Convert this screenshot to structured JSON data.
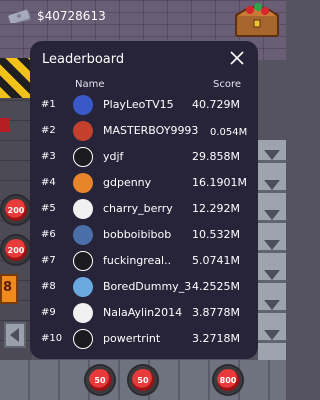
{
  "hud": {
    "money": "$40728613",
    "money_icon": "cash-stack-icon",
    "chest_icon": "treasure-chest-icon"
  },
  "leaderboard": {
    "title": "Leaderboard",
    "close_icon": "close-icon",
    "columns": {
      "name": "Name",
      "score": "Score"
    },
    "rows": [
      {
        "rank": "#1",
        "name": "PlayLeoTV15",
        "score": "40.729M",
        "avatar": "avatar-1",
        "avatar_color": "#3a59c9"
      },
      {
        "rank": "#2",
        "name": "MASTERBOY9993",
        "score": "0.054M",
        "avatar": "avatar-2",
        "avatar_color": "#c2402c"
      },
      {
        "rank": "#3",
        "name": "ydjf",
        "score": "29.858M",
        "avatar": "avatar-3",
        "avatar_color": "#1b1b1f"
      },
      {
        "rank": "#4",
        "name": "gdpenny",
        "score": "16.1901M",
        "avatar": "avatar-4",
        "avatar_color": "#e8842a"
      },
      {
        "rank": "#5",
        "name": "charry_berry",
        "score": "12.292M",
        "avatar": "avatar-5",
        "avatar_color": "#f1f1f1"
      },
      {
        "rank": "#6",
        "name": "bobboibibob",
        "score": "10.532M",
        "avatar": "avatar-6",
        "avatar_color": "#4a6ea8"
      },
      {
        "rank": "#7",
        "name": "fuckingreal..",
        "score": "5.0741M",
        "avatar": "avatar-7",
        "avatar_color": "#1b1b1f"
      },
      {
        "rank": "#8",
        "name": "BoredDummy_3",
        "score": "4.2525M",
        "avatar": "avatar-8",
        "avatar_color": "#6aa8e0"
      },
      {
        "rank": "#9",
        "name": "NalaAylin2014",
        "score": "3.8778M",
        "avatar": "avatar-9",
        "avatar_color": "#f1f1f1"
      },
      {
        "rank": "#10",
        "name": "powertrint",
        "score": "3.2718M",
        "avatar": "avatar-10",
        "avatar_color": "#1b1b1f"
      }
    ]
  },
  "game": {
    "button_200_a": "200",
    "button_200_b": "200",
    "tile_value": "8",
    "button_50_a": "50",
    "button_50_b": "50",
    "button_800": "800"
  }
}
